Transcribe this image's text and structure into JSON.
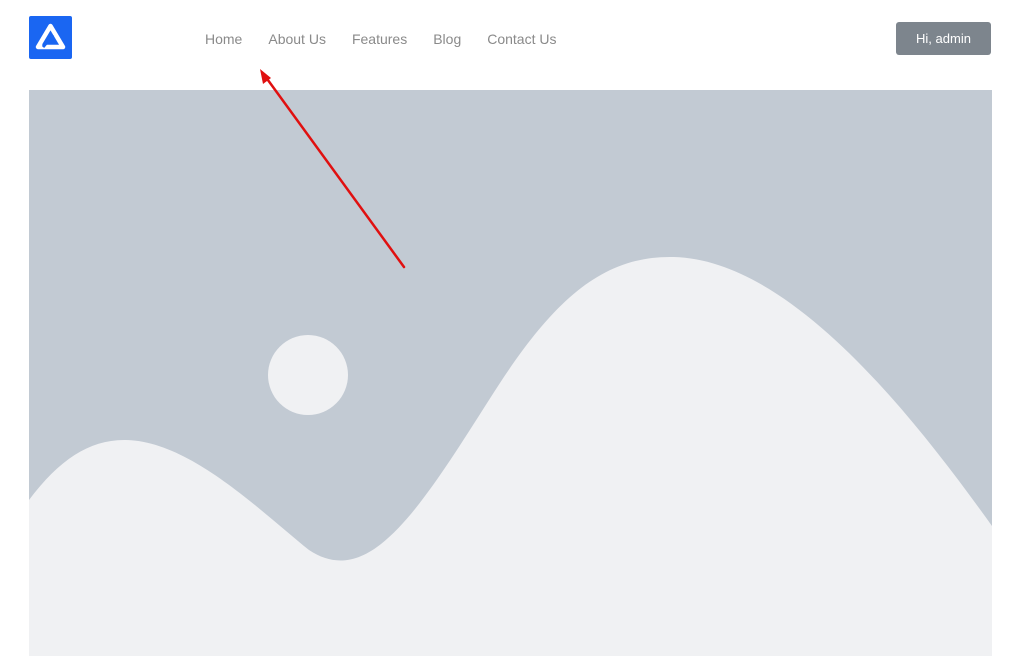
{
  "logo": {
    "icon": "brand-logo-icon",
    "color": "#1a66f2"
  },
  "nav": {
    "items": [
      {
        "label": "Home"
      },
      {
        "label": "About Us"
      },
      {
        "label": "Features"
      },
      {
        "label": "Blog"
      },
      {
        "label": "Contact Us"
      }
    ]
  },
  "user_button": {
    "label": "Hi, admin",
    "color": "#7d858d"
  },
  "hero": {
    "icon": "image-placeholder-icon",
    "background_color": "#c2cad3",
    "foreground_color": "#f0f1f3"
  },
  "annotation": {
    "icon": "red-arrow-icon",
    "color": "#e01010"
  }
}
